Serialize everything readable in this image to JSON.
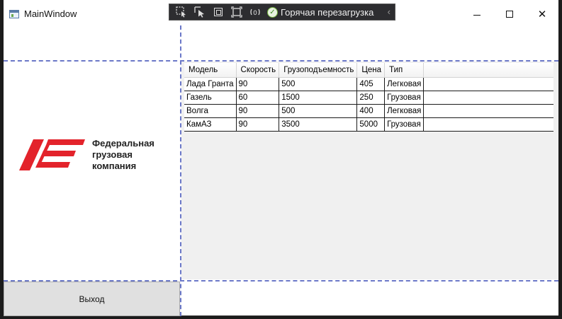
{
  "window": {
    "title": "MainWindow",
    "minimize_glyph": "—",
    "close_glyph": "✕"
  },
  "dev_toolbar": {
    "hot_reload_label": "Горячая перезагрузка",
    "icons": [
      "select-element-icon",
      "select-pointer-icon",
      "display-adorners-icon",
      "track-focus-icon",
      "binding-failures-icon",
      "hot-reload-check-icon",
      "collapse-chevron-icon"
    ]
  },
  "logo": {
    "line1": "Федеральная",
    "line2": "грузовая",
    "line3": "компания",
    "brand_color": "#e3232b"
  },
  "grid": {
    "columns": [
      "Модель",
      "Скорость",
      "Грузоподъемность",
      "Цена",
      "Тип"
    ],
    "rows": [
      [
        "Лада Гранта",
        "90",
        "500",
        "405",
        "Легковая"
      ],
      [
        "Газель",
        "60",
        "1500",
        "250",
        "Грузовая"
      ],
      [
        "Волга",
        "90",
        "500",
        "400",
        "Легковая"
      ],
      [
        "КамАЗ",
        "90",
        "3500",
        "5000",
        "Грузовая"
      ]
    ]
  },
  "exit_button": {
    "label": "Выход"
  },
  "colors": {
    "guide_lines": "#6b78c8",
    "grid_background": "#f0f0f0",
    "button_background": "#e0e0e0"
  }
}
